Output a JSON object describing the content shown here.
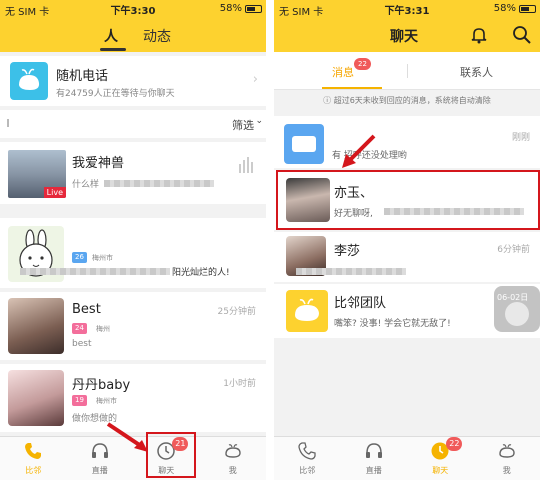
{
  "left": {
    "status": {
      "carrier": "无 SIM 卡",
      "time": "下午3:30",
      "battery": "58%"
    },
    "tabs": [
      {
        "label": "人",
        "active": true
      },
      {
        "label": "动态",
        "active": false
      }
    ],
    "random_call": {
      "title": "随机电话",
      "subtitle": "有24759人正在等待与你聊天"
    },
    "filter_label": "筛选",
    "live": {
      "name": "我爱神兽",
      "snippet": "什么样",
      "badge": "Live"
    },
    "users": [
      {
        "name": "",
        "snippet": "阳光灿烂的人!",
        "badge": "26",
        "city": "梅州市",
        "time": ""
      },
      {
        "name": "Best",
        "snippet": "best",
        "badge": "24",
        "city": "梅州",
        "time": "25分钟前"
      },
      {
        "name": "丹丹baby",
        "snippet": "做你想做的",
        "badge": "19",
        "city": "梅州市",
        "time": "1小时前"
      }
    ],
    "tabbar": [
      {
        "label": "比邻",
        "icon": "phone-icon",
        "active": true
      },
      {
        "label": "直播",
        "icon": "headphones-icon",
        "active": false
      },
      {
        "label": "聊天",
        "icon": "clock-icon",
        "active": false,
        "badge": "21"
      },
      {
        "label": "我",
        "icon": "whale-icon",
        "active": false
      }
    ]
  },
  "right": {
    "status": {
      "carrier": "无 SIM 卡",
      "time": "下午3:31",
      "battery": "58%"
    },
    "title": "聊天",
    "segments": [
      {
        "label": "消息",
        "badge": "22",
        "active": true
      },
      {
        "label": "联系人",
        "active": false
      }
    ],
    "notice": "超过6天未收到回应的消息，系统将自动清除",
    "chats": [
      {
        "name": "",
        "snippet": "有 招呼还没处理哟",
        "time": "刚刚"
      },
      {
        "name": "亦玉、",
        "snippet": "好无聊呀,",
        "time": ""
      },
      {
        "name": "李莎",
        "snippet": "",
        "time": "6分钟前"
      },
      {
        "name": "比邻团队",
        "snippet": "嘴笨? 没事! 学会它就无敌了!",
        "time": "06-02日"
      }
    ],
    "tabbar": [
      {
        "label": "比邻",
        "icon": "phone-icon",
        "active": false
      },
      {
        "label": "直播",
        "icon": "headphones-icon",
        "active": false
      },
      {
        "label": "聊天",
        "icon": "clock-icon",
        "active": true,
        "badge": "22"
      },
      {
        "label": "我",
        "icon": "whale-icon",
        "active": false
      }
    ]
  },
  "colors": {
    "brand_yellow": "#fdd22f",
    "highlight_red": "#d4161c",
    "badge_red": "#f05a5a"
  }
}
